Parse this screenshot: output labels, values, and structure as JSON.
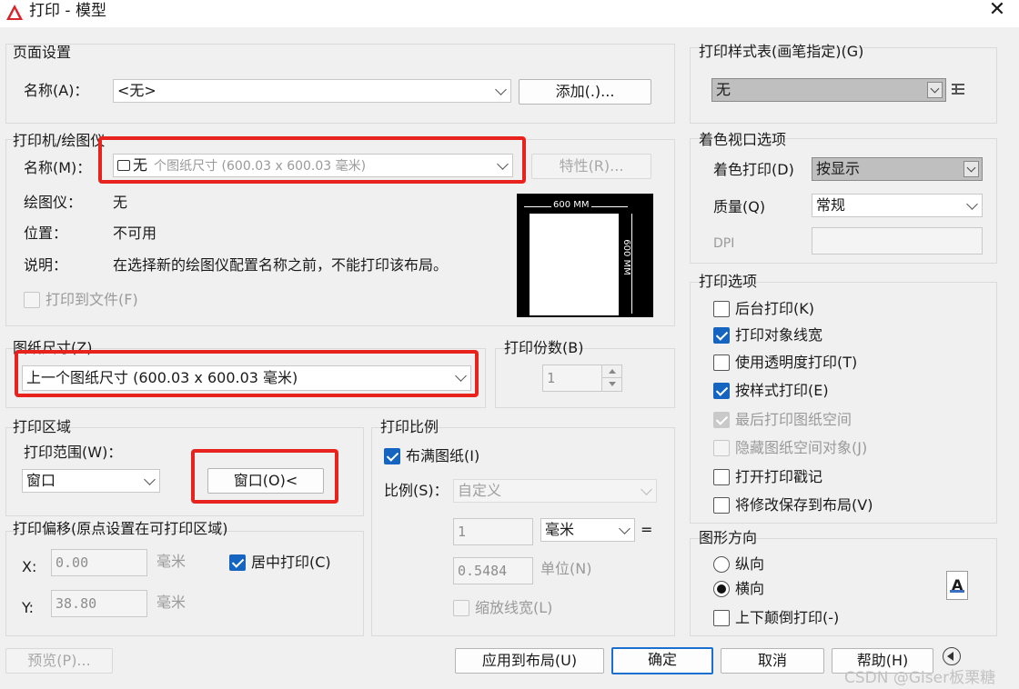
{
  "window": {
    "title": "打印 - 模型",
    "close_symbol": "✕"
  },
  "page_setup": {
    "title": "页面设置",
    "name_label": "名称(A)：",
    "name_value": "<无>",
    "add_button": "添加(.)..."
  },
  "printer": {
    "title": "打印机/绘图仪",
    "name_label": "名称(M)：",
    "name_value": "无",
    "name_value_faded": "个图纸尺寸 (600.03 x 600.03 毫米)",
    "properties_button": "特性(R)...",
    "plotter_label": "绘图仪：",
    "plotter_value": "无",
    "location_label": "位置：",
    "location_value": "不可用",
    "description_label": "说明：",
    "description_value": "在选择新的绘图仪配置名称之前，不能打印该布局。",
    "print_to_file": "打印到文件(F)",
    "preview_width_label": "600 MM",
    "preview_height_label": "600 MM"
  },
  "paper_size": {
    "title": "图纸尺寸(Z)",
    "value": "上一个图纸尺寸 (600.03 x 600.03 毫米)"
  },
  "copies": {
    "title": "打印份数(B)",
    "value": "1"
  },
  "plot_area": {
    "title": "打印区域",
    "range_label": "打印范围(W)：",
    "range_value": "窗口",
    "window_button": "窗口(O)<"
  },
  "plot_offset": {
    "title": "打印偏移(原点设置在可打印区域)",
    "x_label": "X:",
    "x_value": "0.00",
    "x_unit": "毫米",
    "y_label": "Y:",
    "y_value": "38.80",
    "y_unit": "毫米",
    "center_label": "居中打印(C)"
  },
  "plot_scale": {
    "title": "打印比例",
    "fit_label": "布满图纸(I)",
    "scale_label": "比例(S)：",
    "scale_value": "自定义",
    "value1": "1",
    "unit1": "毫米",
    "equals": "=",
    "value2": "0.5484",
    "unit2": "单位(N)",
    "scale_lineweights": "缩放线宽(L)"
  },
  "plot_style": {
    "title": "打印样式表(画笔指定)(G)",
    "value": "无"
  },
  "shaded_viewport": {
    "title": "着色视口选项",
    "shade_label": "着色打印(D)",
    "shade_value": "按显示",
    "quality_label": "质量(Q)",
    "quality_value": "常规",
    "dpi_label": "DPI",
    "dpi_value": ""
  },
  "plot_options": {
    "title": "打印选项",
    "items": [
      {
        "label": "后台打印(K)"
      },
      {
        "label": "打印对象线宽"
      },
      {
        "label": "使用透明度打印(T)"
      },
      {
        "label": "按样式打印(E)"
      },
      {
        "label": "最后打印图纸空间"
      },
      {
        "label": "隐藏图纸空间对象(J)"
      },
      {
        "label": "打开打印戳记"
      },
      {
        "label": "将修改保存到布局(V)"
      }
    ]
  },
  "orientation": {
    "title": "图形方向",
    "portrait": "纵向",
    "landscape": "横向",
    "upside_down": "上下颠倒打印(-)",
    "icon_letter": "A"
  },
  "footer": {
    "preview": "预览(P)...",
    "apply": "应用到布局(U)",
    "ok": "确定",
    "cancel": "取消",
    "help": "帮助(H)"
  },
  "watermark": "CSDN @Giser板栗糖",
  "colors": {
    "highlight": "#e8231e",
    "checkbox_checked": "#1565c0",
    "primary_border": "#1a6fd1"
  }
}
